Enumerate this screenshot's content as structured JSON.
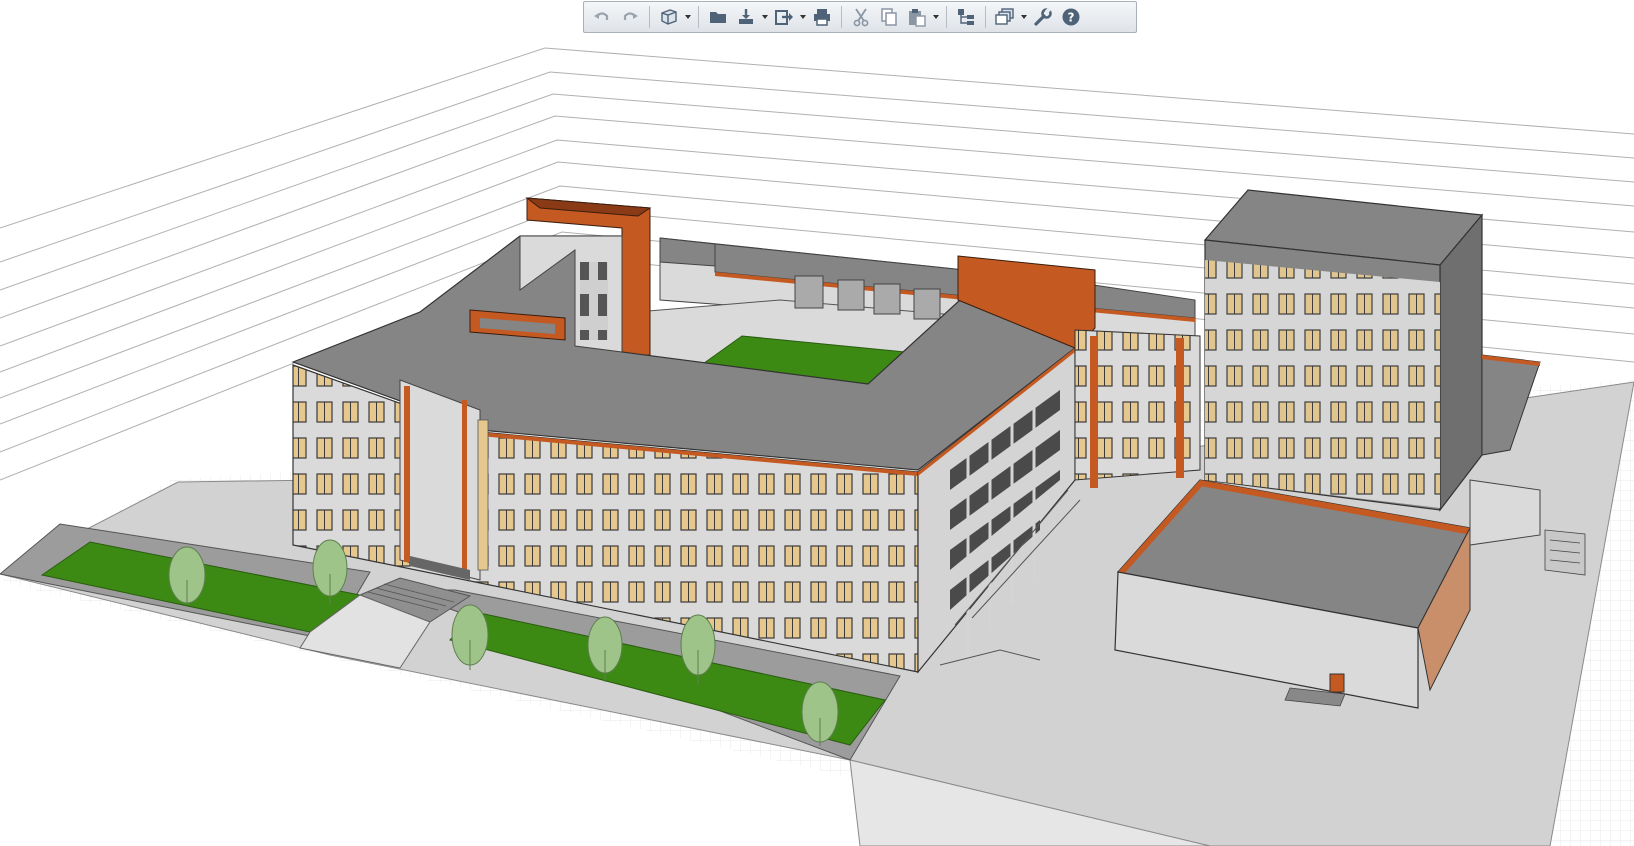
{
  "app": {
    "view": "3d-model-view"
  },
  "toolbar": {
    "buttons": [
      {
        "id": "undo",
        "icon": "undo-icon",
        "enabled": false
      },
      {
        "id": "redo",
        "icon": "redo-icon",
        "enabled": false
      },
      {
        "id": "new-3d",
        "icon": "cube-icon",
        "has_dropdown": true
      },
      {
        "id": "open",
        "icon": "folder-icon"
      },
      {
        "id": "import",
        "icon": "import-icon",
        "has_dropdown": true
      },
      {
        "id": "export",
        "icon": "export-icon",
        "has_dropdown": true
      },
      {
        "id": "print",
        "icon": "printer-icon"
      },
      {
        "id": "cut",
        "icon": "scissors-icon"
      },
      {
        "id": "copy",
        "icon": "copy-icon"
      },
      {
        "id": "paste",
        "icon": "paste-icon",
        "has_dropdown": true
      },
      {
        "id": "project-tree",
        "icon": "tree-icon"
      },
      {
        "id": "layers",
        "icon": "layers-icon",
        "has_dropdown": true
      },
      {
        "id": "settings",
        "icon": "wrench-icon"
      },
      {
        "id": "help",
        "icon": "help-icon"
      }
    ]
  },
  "colors": {
    "roof": "#858585",
    "wall": "#dadada",
    "accent": "#c45a22",
    "lawn": "#3c8a14",
    "window": "#e6c88f",
    "ground": "#d2d2d2",
    "toolbar_icon": "#4e6278"
  }
}
